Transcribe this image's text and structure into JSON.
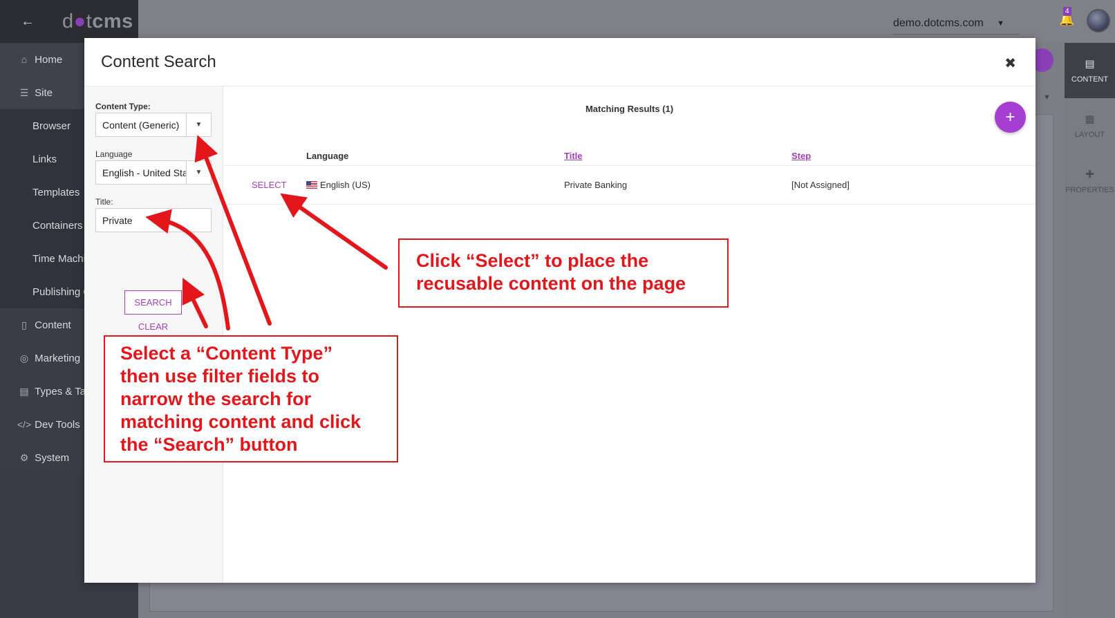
{
  "app": {
    "logo_text": "dotcms",
    "site_name": "demo.dotcms.com",
    "notification_count": "4"
  },
  "sidebar": {
    "items": [
      {
        "label": "Home",
        "icon": "home-icon"
      },
      {
        "label": "Site",
        "icon": "sitemap-icon"
      },
      {
        "label": "Browser"
      },
      {
        "label": "Links"
      },
      {
        "label": "Templates"
      },
      {
        "label": "Containers"
      },
      {
        "label": "Time Machi"
      },
      {
        "label": "Publishing Q"
      },
      {
        "label": "Content",
        "icon": "folder-icon"
      },
      {
        "label": "Marketing",
        "icon": "target-icon"
      },
      {
        "label": "Types & Tag",
        "icon": "file-icon"
      },
      {
        "label": "Dev Tools",
        "icon": "code-icon"
      },
      {
        "label": "System",
        "icon": "gear-icon"
      }
    ]
  },
  "right_rail": {
    "items": [
      {
        "label": "CONTENT",
        "icon": "document-icon",
        "active": true
      },
      {
        "label": "LAYOUT",
        "icon": "grid-icon",
        "active": false
      },
      {
        "label": "PROPERTIES",
        "icon": "plus-icon",
        "active": false
      }
    ]
  },
  "modal": {
    "title": "Content Search",
    "filters": {
      "content_type_label": "Content Type:",
      "content_type_value": "Content (Generic)",
      "language_label": "Language",
      "language_value": "English - United States",
      "title_label": "Title:",
      "title_value": "Private",
      "search_label": "SEARCH",
      "clear_label": "CLEAR"
    },
    "results": {
      "heading": "Matching Results (1)",
      "columns": [
        "Language",
        "Title",
        "Step"
      ],
      "rows": [
        {
          "action": "SELECT",
          "language": "English (US)",
          "title": "Private Banking",
          "step": "[Not Assigned]"
        }
      ]
    }
  },
  "annotations": {
    "select_callout_lines": [
      "Click “Select” to place the",
      "recusable content on the page"
    ],
    "search_callout_lines": [
      "Select a “Content Type”",
      "then use filter fields to",
      "narrow the search for",
      "matching content and click",
      "the “Search” button"
    ],
    "color": "#e3171b"
  },
  "colors": {
    "accent": "#a33fb7",
    "sidebar_bg": "#383b44"
  }
}
